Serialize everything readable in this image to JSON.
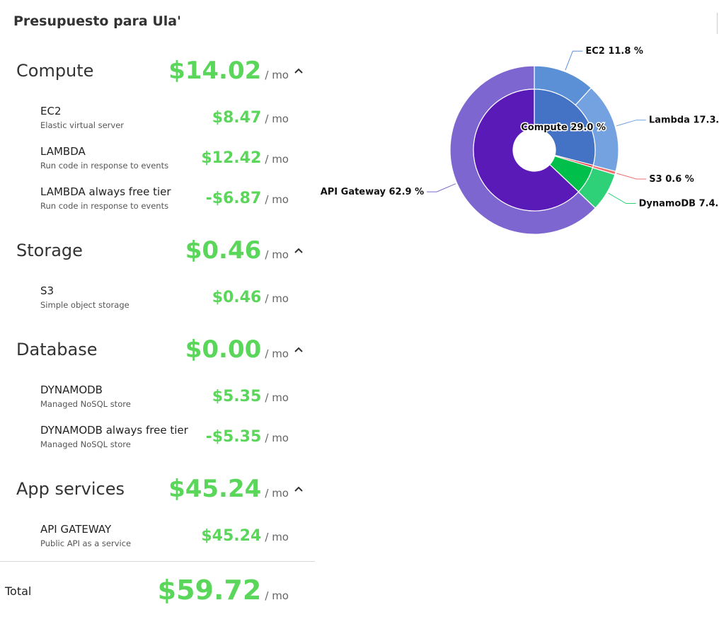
{
  "page": {
    "title": "Presupuesto para Ula'"
  },
  "unit": "/ mo",
  "categories": [
    {
      "name": "Compute",
      "price": "$14.02",
      "services": [
        {
          "name": "EC2",
          "desc": "Elastic virtual server",
          "price": "$8.47"
        },
        {
          "name": "LAMBDA",
          "desc": "Run code in response to events",
          "price": "$12.42"
        },
        {
          "name": "LAMBDA always free tier",
          "desc": "Run code in response to events",
          "price": "-$6.87"
        }
      ]
    },
    {
      "name": "Storage",
      "price": "$0.46",
      "services": [
        {
          "name": "S3",
          "desc": "Simple object storage",
          "price": "$0.46"
        }
      ]
    },
    {
      "name": "Database",
      "price": "$0.00",
      "services": [
        {
          "name": "DYNAMODB",
          "desc": "Managed NoSQL store",
          "price": "$5.35"
        },
        {
          "name": "DYNAMODB always free tier",
          "desc": "Managed NoSQL store",
          "price": "-$5.35"
        }
      ]
    },
    {
      "name": "App services",
      "price": "$45.24",
      "services": [
        {
          "name": "API GATEWAY",
          "desc": "Public API as a service",
          "price": "$45.24"
        }
      ]
    }
  ],
  "total": {
    "label": "Total",
    "price": "$59.72"
  },
  "icons": {
    "collapse": "chevron-up-icon"
  },
  "colors": {
    "price": "#5ad65a"
  },
  "chart_data": {
    "type": "pie",
    "inner": [
      {
        "name": "Compute",
        "value": 29.0,
        "label": "Compute 29.0 %",
        "color": "#4472c4"
      },
      {
        "name": "Storage",
        "value": 0.6,
        "label": "",
        "color": "#e8393a"
      },
      {
        "name": "Database",
        "value": 7.4,
        "label": "",
        "color": "#00c04b"
      },
      {
        "name": "App services",
        "value": 62.9,
        "label": "",
        "color": "#5a1ab8"
      }
    ],
    "outer": [
      {
        "name": "EC2",
        "value": 11.8,
        "label": "EC2 11.8 %",
        "color": "#5b8fd6"
      },
      {
        "name": "Lambda",
        "value": 17.3,
        "label": "Lambda 17.3…",
        "color": "#74a2e0"
      },
      {
        "name": "S3",
        "value": 0.6,
        "label": "S3 0.6 %",
        "color": "#f07070"
      },
      {
        "name": "DynamoDB",
        "value": 7.4,
        "label": "DynamoDB 7.4…",
        "color": "#2ed178"
      },
      {
        "name": "API Gateway",
        "value": 62.9,
        "label": "API Gateway 62.9 %",
        "color": "#7e66d0"
      }
    ]
  }
}
